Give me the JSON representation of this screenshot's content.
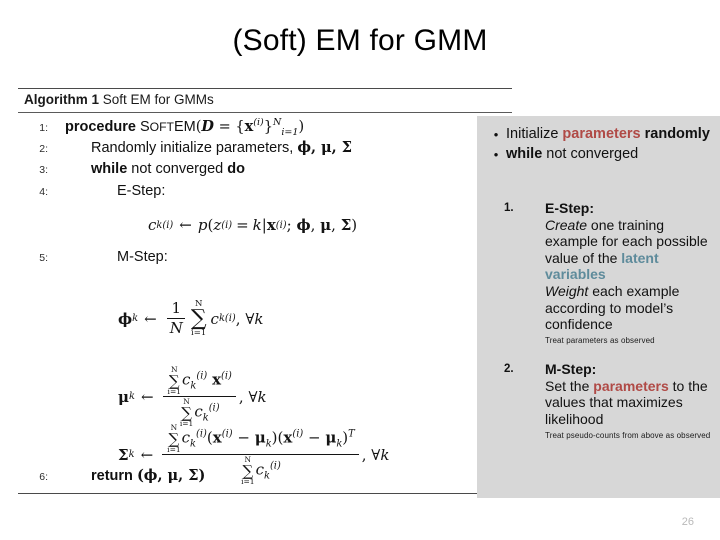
{
  "slide": {
    "title": "(Soft) EM for GMM",
    "page_number": "26"
  },
  "algorithm": {
    "caption_strong": "Algorithm 1",
    "caption_rest": "Soft EM for GMMs",
    "lines": [
      {
        "no": "1:",
        "text": "procedure SoftEM(D = {x(i)}Ni=1)"
      },
      {
        "no": "2:",
        "text": "Randomly initialize parameters, ϕ, μ, Σ"
      },
      {
        "no": "3:",
        "text": "while not converged do"
      },
      {
        "no": "4:",
        "text": "E-Step:"
      },
      {
        "no": "5:",
        "text": "M-Step:"
      },
      {
        "no": "6:",
        "text": "return (ϕ, μ, Σ)"
      }
    ],
    "line1": {
      "keyword": "procedure",
      "proc_name": "SoftEM",
      "arg": "(D = {x(i)}Ni=1)"
    },
    "line2": {
      "text": "Randomly initialize parameters, ",
      "params": "ϕ, μ, Σ"
    },
    "line3": {
      "kw_while": "while",
      "mid": " not converged ",
      "kw_do": "do"
    },
    "line4_label": "E-Step:",
    "line5_label": "M-Step:",
    "line6": {
      "keyword": "return",
      "args": "(ϕ, μ, Σ)"
    },
    "equations": {
      "estep": "c_k^(i) ← p(z^(i) = k | x^(i); ϕ, μ, Σ)",
      "phi": "ϕ_k ← (1/N) Σ_{i=1}^{N} c_k^(i), ∀k",
      "mu": "μ_k ← ( Σ_{i=1}^{N} c_k^(i) x^(i) ) / ( Σ_{i=1}^{N} c_k^(i) ), ∀k",
      "sigma": "Σ_k ← ( Σ_{i=1}^{N} c_k^(i) (x^(i) − μ_k)(x^(i) − μ_k)^T ) / ( Σ_{i=1}^{N} c_k^(i) ), ∀k"
    }
  },
  "panel": {
    "bullet_marker": "•",
    "bullets": [
      {
        "pre": "Initialize ",
        "accent": "parameters",
        "post": " randomly"
      },
      {
        "pre": "",
        "bold_lead": "while",
        "post": " not converged"
      }
    ],
    "steps": [
      {
        "index": "1.",
        "head": "E-Step:",
        "italic1": "Create",
        "body1": " one training example for each possible value of the ",
        "accent": "latent variables",
        "italic2": "Weight",
        "body2": " each example according to model’s confidence",
        "note": "Treat parameters as observed"
      },
      {
        "index": "2.",
        "head": "M-Step:",
        "body_pre": "Set the ",
        "accent": "parameters",
        "body_post": " to the values that maximizes likelihood",
        "note": "Treat pseudo-counts from above as observed"
      }
    ]
  },
  "colors": {
    "accent_red": "#b04a46",
    "accent_teal": "#5e8b9b",
    "panel_bg": "#d7d7d7",
    "page_number": "#b9b9b9"
  }
}
